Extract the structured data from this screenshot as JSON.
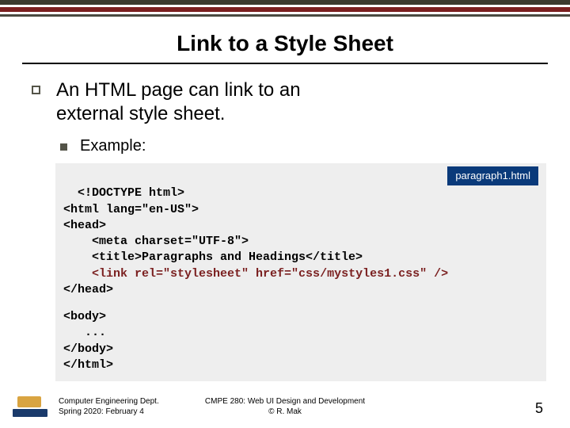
{
  "title": "Link to a Style Sheet",
  "bullet1_line1": "An HTML page can link to an",
  "bullet1_line2": "external style sheet.",
  "bullet2": "Example:",
  "file_badge": "paragraph1.html",
  "code": {
    "l1": "<!DOCTYPE html>",
    "l2": "<html lang=\"en-US\">",
    "l3": "<head>",
    "l4": "    <meta charset=\"UTF-8\">",
    "l5": "    <title>Paragraphs and Headings</title>",
    "l6a": "    ",
    "l6b": "<link rel=\"stylesheet\" href=\"css/mystyles1.css\" />",
    "l7": "</head>",
    "l8": "<body>",
    "l9": "   ...",
    "l10": "</body>",
    "l11": "</html>"
  },
  "footer": {
    "left1": "Computer Engineering Dept.",
    "left2": "Spring 2020: February 4",
    "center1": "CMPE 280: Web UI Design and Development",
    "center2": "© R. Mak",
    "page": "5"
  }
}
